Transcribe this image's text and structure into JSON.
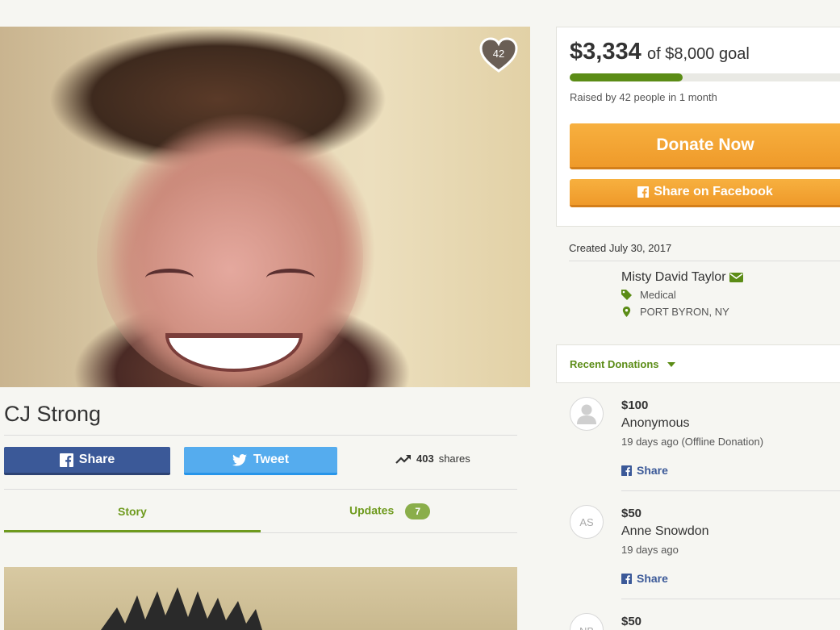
{
  "campaign": {
    "title": "CJ Strong",
    "hearts_count": "42"
  },
  "social": {
    "share_label": "Share",
    "tweet_label": "Tweet",
    "shares_count": "403",
    "shares_label": "shares"
  },
  "tabs": [
    {
      "label": "Story"
    },
    {
      "label": "Updates",
      "badge": "7"
    }
  ],
  "goal": {
    "raised": "$3,334",
    "goal_text": "of $8,000 goal",
    "progress_fraction": 0.417,
    "raised_by": "Raised by 42 people in 1 month",
    "donate_label": "Donate Now",
    "share_fb_label": "Share on Facebook"
  },
  "info": {
    "created": "Created July 30, 2017",
    "organizer": "Misty David Taylor",
    "category": "Medical",
    "location": "PORT BYRON, NY"
  },
  "donations": {
    "header": "Recent Donations",
    "items": [
      {
        "amount": "$100",
        "name": "Anonymous",
        "time": "19 days ago (Offline Donation)",
        "share": "Share",
        "initials": ""
      },
      {
        "amount": "$50",
        "name": "Anne Snowdon",
        "time": "19 days ago",
        "share": "Share",
        "initials": "AS"
      },
      {
        "amount": "$50",
        "initials": "NB"
      }
    ]
  },
  "colors": {
    "accent_green": "#5b8c16",
    "donate_orange": "#f4a436",
    "facebook_blue": "#3b5998",
    "twitter_blue": "#55acee"
  }
}
